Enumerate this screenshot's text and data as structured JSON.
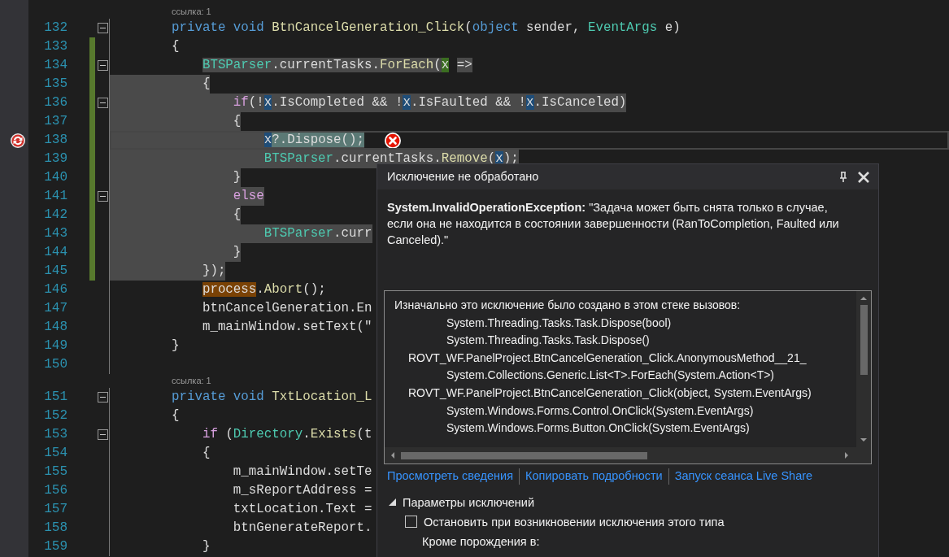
{
  "editor": {
    "lines": [
      {
        "codelens": "ссылка: 1",
        "number": "132",
        "changed": false,
        "collapsible": true,
        "selected": false,
        "tokens": [
          {
            "text": "private void ",
            "kind": "keyword"
          },
          {
            "text": "BtnCancelGeneration_Click",
            "kind": "method"
          },
          {
            "text": "(",
            "kind": "plain"
          },
          {
            "text": "object ",
            "kind": "keyword"
          },
          {
            "text": "sender, ",
            "kind": "plain"
          },
          {
            "text": "EventArgs",
            "kind": "type"
          },
          {
            "text": " e)",
            "kind": "plain"
          }
        ]
      },
      {
        "number": "133",
        "changed": true,
        "collapsible": false,
        "selected": false,
        "tokens": [
          {
            "text": "{",
            "kind": "plain"
          }
        ]
      },
      {
        "number": "134",
        "changed": true,
        "collapsible": true,
        "selected": true,
        "selection_starts_at_text": true,
        "tokens": [
          {
            "text": "    BTSParser",
            "kind": "type"
          },
          {
            "text": ".currentTasks.",
            "kind": "plain"
          },
          {
            "text": "ForEach",
            "kind": "method"
          },
          {
            "text": "(",
            "kind": "plain"
          },
          {
            "text": "x",
            "kind": "plain",
            "definition": true
          },
          {
            "text": " =>",
            "kind": "plain"
          }
        ]
      },
      {
        "number": "135",
        "changed": true,
        "collapsible": false,
        "selected": true,
        "tokens": [
          {
            "text": "    {",
            "kind": "plain"
          }
        ]
      },
      {
        "number": "136",
        "changed": true,
        "collapsible": true,
        "selected": true,
        "tokens": [
          {
            "text": "        if",
            "kind": "control"
          },
          {
            "text": "(!",
            "kind": "plain"
          },
          {
            "text": "x",
            "kind": "plain",
            "reference": true
          },
          {
            "text": ".IsCompleted && !",
            "kind": "plain"
          },
          {
            "text": "x",
            "kind": "plain",
            "reference": true
          },
          {
            "text": ".IsFaulted && !",
            "kind": "plain"
          },
          {
            "text": "x",
            "kind": "plain",
            "reference": true
          },
          {
            "text": ".IsCanceled)",
            "kind": "plain"
          }
        ]
      },
      {
        "number": "137",
        "changed": true,
        "collapsible": false,
        "selected": true,
        "tokens": [
          {
            "text": "        {",
            "kind": "plain"
          }
        ]
      },
      {
        "number": "138",
        "changed": true,
        "collapsible": false,
        "selected": true,
        "current": true,
        "exception": true,
        "tokens": [
          {
            "text": "            x",
            "kind": "plain",
            "reference": true
          },
          {
            "text": "?.Dispose();",
            "kind": "plain",
            "current_statement": true
          }
        ]
      },
      {
        "number": "139",
        "changed": true,
        "collapsible": false,
        "selected": true,
        "tokens": [
          {
            "text": "            BTSParser",
            "kind": "type"
          },
          {
            "text": ".currentTasks.",
            "kind": "plain"
          },
          {
            "text": "Remove",
            "kind": "method"
          },
          {
            "text": "(",
            "kind": "plain"
          },
          {
            "text": "x",
            "kind": "plain",
            "reference": true
          },
          {
            "text": ");",
            "kind": "plain"
          }
        ]
      },
      {
        "number": "140",
        "changed": true,
        "collapsible": false,
        "selected": true,
        "tokens": [
          {
            "text": "        }",
            "kind": "plain"
          }
        ]
      },
      {
        "number": "141",
        "changed": true,
        "collapsible": true,
        "selected": true,
        "tokens": [
          {
            "text": "        else",
            "kind": "control"
          }
        ]
      },
      {
        "number": "142",
        "changed": true,
        "collapsible": false,
        "selected": true,
        "tokens": [
          {
            "text": "        {",
            "kind": "plain"
          }
        ]
      },
      {
        "number": "143",
        "changed": true,
        "collapsible": false,
        "selected": true,
        "tokens": [
          {
            "text": "            BTSParser",
            "kind": "type"
          },
          {
            "text": ".curr",
            "kind": "plain"
          }
        ]
      },
      {
        "number": "144",
        "changed": true,
        "collapsible": false,
        "selected": true,
        "tokens": [
          {
            "text": "        }",
            "kind": "plain"
          }
        ]
      },
      {
        "number": "145",
        "changed": true,
        "collapsible": false,
        "selected": true,
        "tokens": [
          {
            "text": "    });",
            "kind": "plain"
          }
        ]
      },
      {
        "number": "146",
        "changed": false,
        "collapsible": false,
        "selected": false,
        "tokens": [
          {
            "text": "    process",
            "kind": "plain",
            "match": true
          },
          {
            "text": ".",
            "kind": "plain"
          },
          {
            "text": "Abort",
            "kind": "method"
          },
          {
            "text": "();",
            "kind": "plain"
          }
        ]
      },
      {
        "number": "147",
        "changed": false,
        "collapsible": false,
        "selected": false,
        "tokens": [
          {
            "text": "    btnCancelGeneration.En",
            "kind": "plain"
          }
        ]
      },
      {
        "number": "148",
        "changed": false,
        "collapsible": false,
        "selected": false,
        "tokens": [
          {
            "text": "    m_mainWindow.setText(\"",
            "kind": "plain"
          }
        ]
      },
      {
        "number": "149",
        "changed": false,
        "collapsible": false,
        "selected": false,
        "tokens": [
          {
            "text": "}",
            "kind": "plain"
          }
        ]
      },
      {
        "number": "150",
        "changed": false,
        "collapsible": false,
        "selected": false
      },
      {
        "codelens": "ссылка: 1",
        "number": "151",
        "changed": false,
        "collapsible": true,
        "selected": false,
        "tokens": [
          {
            "text": "private void ",
            "kind": "keyword"
          },
          {
            "text": "TxtLocation_L",
            "kind": "method"
          }
        ]
      },
      {
        "number": "152",
        "changed": false,
        "collapsible": false,
        "selected": false,
        "tokens": [
          {
            "text": "{",
            "kind": "plain"
          }
        ]
      },
      {
        "number": "153",
        "changed": false,
        "collapsible": true,
        "selected": false,
        "tokens": [
          {
            "text": "    if",
            "kind": "control"
          },
          {
            "text": " (",
            "kind": "plain"
          },
          {
            "text": "Directory",
            "kind": "type"
          },
          {
            "text": ".",
            "kind": "plain"
          },
          {
            "text": "Exists",
            "kind": "method"
          },
          {
            "text": "(t",
            "kind": "plain"
          }
        ]
      },
      {
        "number": "154",
        "changed": false,
        "collapsible": false,
        "selected": false,
        "tokens": [
          {
            "text": "    {",
            "kind": "plain"
          }
        ]
      },
      {
        "number": "155",
        "changed": false,
        "collapsible": false,
        "selected": false,
        "tokens": [
          {
            "text": "        m_mainWindow.setTe",
            "kind": "plain"
          }
        ]
      },
      {
        "number": "156",
        "changed": false,
        "collapsible": false,
        "selected": false,
        "tokens": [
          {
            "text": "        m_sReportAddress =",
            "kind": "plain"
          }
        ]
      },
      {
        "number": "157",
        "changed": false,
        "collapsible": false,
        "selected": false,
        "tokens": [
          {
            "text": "        txtLocation.Text =",
            "kind": "plain"
          }
        ]
      },
      {
        "number": "158",
        "changed": false,
        "collapsible": false,
        "selected": false,
        "tokens": [
          {
            "text": "        btnGenerateReport.",
            "kind": "plain"
          }
        ]
      },
      {
        "number": "159",
        "changed": false,
        "collapsible": false,
        "selected": false,
        "tokens": [
          {
            "text": "    }",
            "kind": "plain"
          }
        ]
      }
    ]
  },
  "exception_popup": {
    "title": "Исключение не обработано",
    "message": "**System.InvalidOperationException:** \"Задача может быть снята только в случае, если она не находится в состоянии завершенности (RanToCompletion, Faulted или Canceled).\"",
    "stack_heading": "Изначально это исключение было создано в этом стеке вызовов:",
    "stack": [
      {
        "text": "System.Threading.Tasks.Task.Dispose(bool)",
        "kind": "external"
      },
      {
        "text": "System.Threading.Tasks.Task.Dispose()",
        "kind": "external"
      },
      {
        "text": "ROVT_WF.PanelProject.BtnCancelGeneration_Click.AnonymousMethod__21_",
        "kind": "user"
      },
      {
        "text": "System.Collections.Generic.List<T>.ForEach(System.Action<T>)",
        "kind": "external"
      },
      {
        "text": "ROVT_WF.PanelProject.BtnCancelGeneration_Click(object, System.EventArgs)",
        "kind": "user"
      },
      {
        "text": "System.Windows.Forms.Control.OnClick(System.EventArgs)",
        "kind": "external"
      },
      {
        "text": "System.Windows.Forms.Button.OnClick(System.EventArgs)",
        "kind": "external"
      }
    ],
    "links": [
      "Просмотреть сведения",
      "Копировать подробности",
      "Запуск сеанса Live Share"
    ],
    "settings": {
      "label": "Параметры исключений",
      "expanded": true,
      "break_option": {
        "label": "Остановить при возникновении исключения этого типа",
        "checked": false
      },
      "except_label": "Кроме порождения в:"
    }
  }
}
